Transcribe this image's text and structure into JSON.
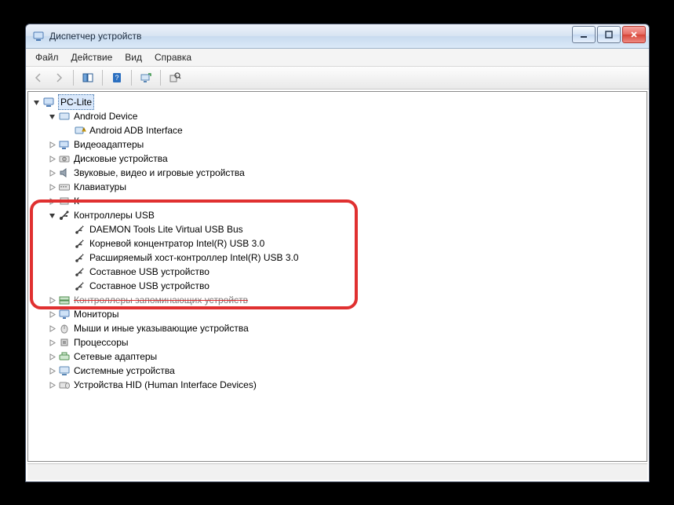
{
  "window": {
    "title": "Диспетчер устройств"
  },
  "menu": {
    "file": "Файл",
    "action": "Действие",
    "view": "Вид",
    "help": "Справка"
  },
  "tree": {
    "root": "PC-Lite",
    "nodes": [
      {
        "label": "Android Device",
        "expanded": true,
        "icon": "device-category",
        "children": [
          {
            "label": "Android ADB Interface",
            "icon": "adb-warn"
          }
        ]
      },
      {
        "label": "Видеоадаптеры",
        "expanded": false,
        "icon": "display-adapter"
      },
      {
        "label": "Дисковые устройства",
        "expanded": false,
        "icon": "disk-drive"
      },
      {
        "label": "Звуковые, видео и игровые устройства",
        "expanded": false,
        "icon": "sound"
      },
      {
        "label": "Клавиатуры",
        "expanded": false,
        "icon": "keyboard"
      },
      {
        "label": "К",
        "expanded": false,
        "icon": "generic",
        "truncated": true
      },
      {
        "label": "Контроллеры USB",
        "expanded": true,
        "icon": "usb-controller",
        "highlight": true,
        "children": [
          {
            "label": "DAEMON Tools Lite Virtual USB Bus",
            "icon": "usb"
          },
          {
            "label": "Корневой концентратор Intel(R) USB 3.0",
            "icon": "usb"
          },
          {
            "label": "Расширяемый хост-контроллер Intel(R) USB 3.0",
            "icon": "usb"
          },
          {
            "label": "Составное USB устройство",
            "icon": "usb"
          },
          {
            "label": "Составное USB устройство",
            "icon": "usb"
          }
        ]
      },
      {
        "label": "Контроллеры запоминающих устройств",
        "expanded": false,
        "icon": "storage-controller",
        "obscured": true
      },
      {
        "label": "Мониторы",
        "expanded": false,
        "icon": "monitor"
      },
      {
        "label": "Мыши и иные указывающие устройства",
        "expanded": false,
        "icon": "mouse"
      },
      {
        "label": "Процессоры",
        "expanded": false,
        "icon": "processor"
      },
      {
        "label": "Сетевые адаптеры",
        "expanded": false,
        "icon": "network"
      },
      {
        "label": "Системные устройства",
        "expanded": false,
        "icon": "system"
      },
      {
        "label": "Устройства HID (Human Interface Devices)",
        "expanded": false,
        "icon": "hid"
      }
    ]
  }
}
